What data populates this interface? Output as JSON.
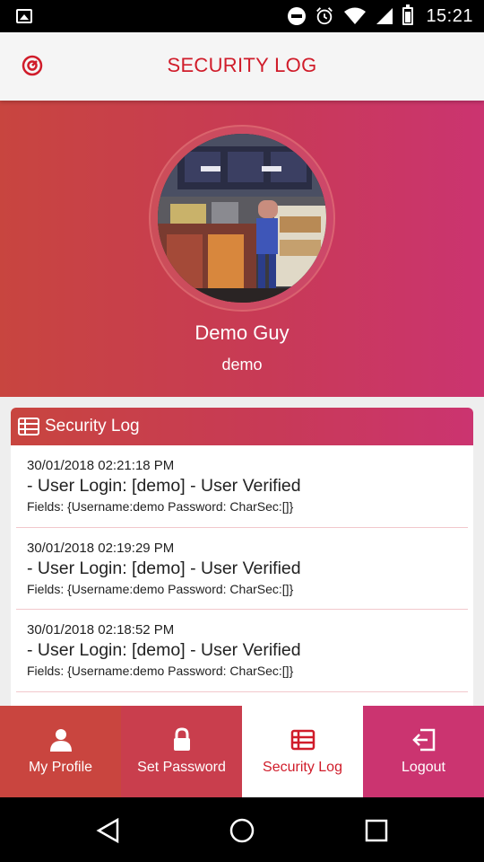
{
  "status_bar": {
    "time": "15:21"
  },
  "app_bar": {
    "title": "SECURITY LOG",
    "logo_icon": "dial-logo-icon"
  },
  "profile": {
    "name": "Demo Guy",
    "username": "demo",
    "avatar_icon": "cafe-photo-avatar"
  },
  "security_log": {
    "title": "Security Log",
    "entries": [
      {
        "date": "30/01/2018 02:21:18 PM",
        "action": "- User Login: [demo] - User Verified",
        "fields": "Fields: {Username:demo Password: CharSec:[]}"
      },
      {
        "date": "30/01/2018 02:19:29 PM",
        "action": "- User Login: [demo] - User Verified",
        "fields": "Fields: {Username:demo Password: CharSec:[]}"
      },
      {
        "date": "30/01/2018 02:18:52 PM",
        "action": "- User Login: [demo] - User Verified",
        "fields": "Fields: {Username:demo Password: CharSec:[]}"
      }
    ]
  },
  "bottom_nav": {
    "items": [
      {
        "label": "My Profile",
        "icon": "user-icon"
      },
      {
        "label": "Set Password",
        "icon": "lock-icon"
      },
      {
        "label": "Security Log",
        "icon": "list-icon",
        "active": true
      },
      {
        "label": "Logout",
        "icon": "logout-icon"
      }
    ]
  },
  "colors": {
    "accent": "#d01c2a",
    "gradient_start": "#c8453f",
    "gradient_end": "#cb3470"
  }
}
